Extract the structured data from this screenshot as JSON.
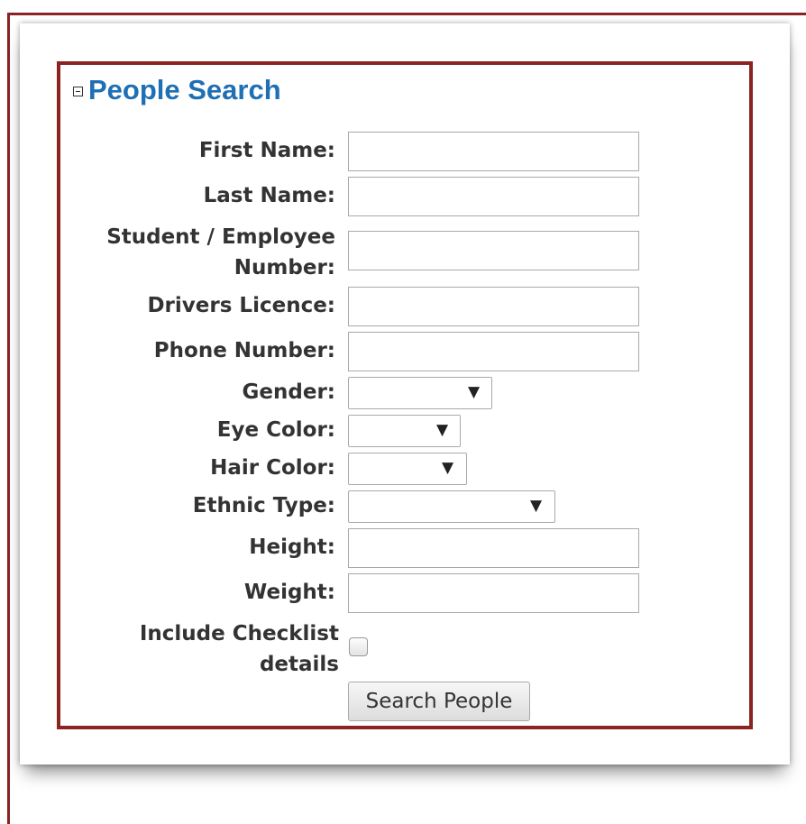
{
  "panel": {
    "title": "People Search",
    "collapse_icon": "minus-box-icon"
  },
  "fields": {
    "first_name": {
      "label": "First Name:",
      "value": ""
    },
    "last_name": {
      "label": "Last Name:",
      "value": ""
    },
    "student_employee_number": {
      "label_line1": "Student / Employee",
      "label_line2": "Number:",
      "value": ""
    },
    "drivers_licence": {
      "label": "Drivers Licence:",
      "value": ""
    },
    "phone_number": {
      "label": "Phone Number:",
      "value": ""
    },
    "gender": {
      "label": "Gender:",
      "selected": ""
    },
    "eye_color": {
      "label": "Eye Color:",
      "selected": ""
    },
    "hair_color": {
      "label": "Hair Color:",
      "selected": ""
    },
    "ethnic_type": {
      "label": "Ethnic Type:",
      "selected": ""
    },
    "height": {
      "label": "Height:",
      "value": ""
    },
    "weight": {
      "label": "Weight:",
      "value": ""
    },
    "include_checklist": {
      "label_line1": "Include Checklist",
      "label_line2": "details",
      "checked": false
    }
  },
  "actions": {
    "search_label": "Search People"
  },
  "colors": {
    "frame": "#8b2323",
    "title": "#1f6fb5"
  },
  "icons": {
    "dropdown": "▼"
  }
}
